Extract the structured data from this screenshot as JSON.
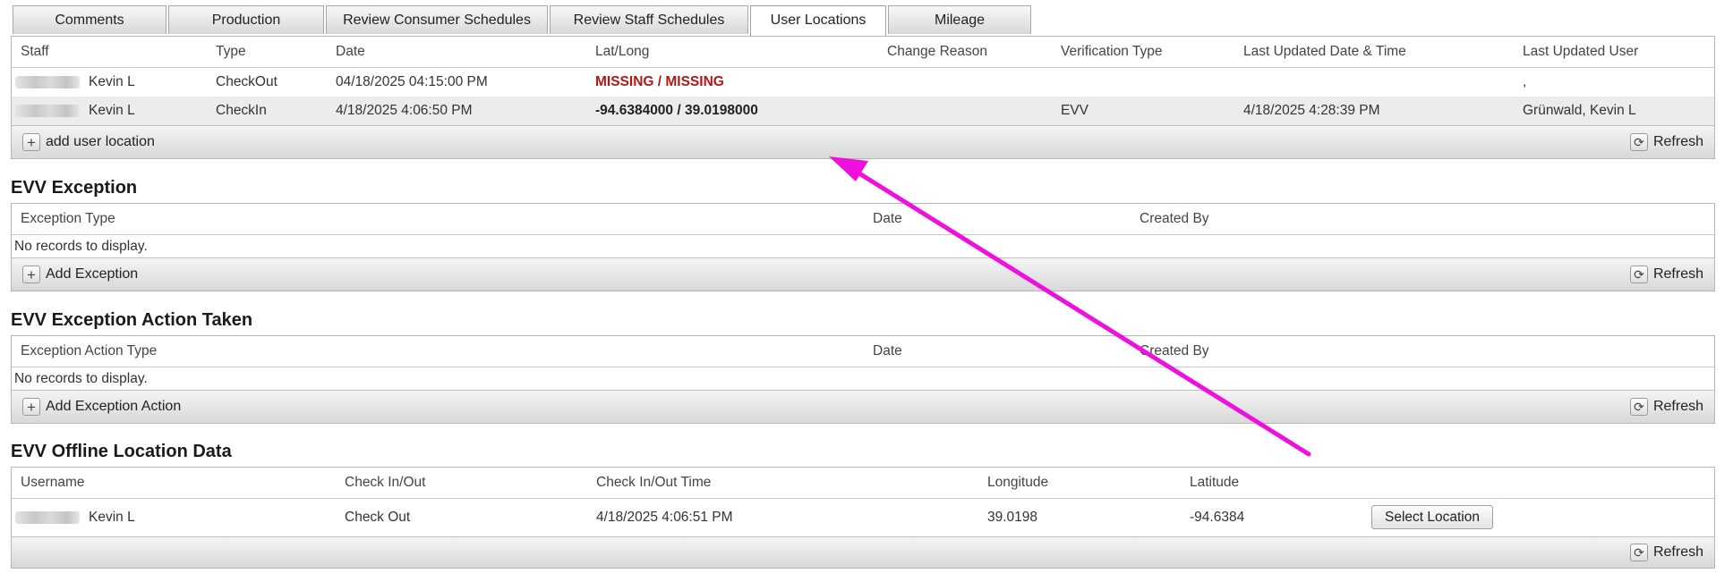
{
  "tabs": [
    {
      "label": "Comments"
    },
    {
      "label": "Production"
    },
    {
      "label": "Review Consumer Schedules"
    },
    {
      "label": "Review Staff Schedules"
    },
    {
      "label": "User Locations"
    },
    {
      "label": "Mileage"
    }
  ],
  "active_tab": "User Locations",
  "user_locations": {
    "columns": [
      "Staff",
      "Type",
      "Date",
      "Lat/Long",
      "Change Reason",
      "Verification Type",
      "Last Updated Date & Time",
      "Last Updated User"
    ],
    "rows": [
      {
        "staff": "Kevin L",
        "type": "CheckOut",
        "date": "04/18/2025 04:15:00 PM",
        "latlong": "MISSING / MISSING",
        "change_reason": "",
        "verification_type": "",
        "last_updated": "",
        "last_user": ","
      },
      {
        "staff": "Kevin L",
        "type": "CheckIn",
        "date": "4/18/2025 4:06:50 PM",
        "latlong": "-94.6384000 / 39.0198000",
        "change_reason": "",
        "verification_type": "EVV",
        "last_updated": "4/18/2025 4:28:39 PM",
        "last_user": "Grünwald, Kevin L"
      }
    ],
    "add_label": "add user location",
    "refresh_label": "Refresh"
  },
  "evv_exception": {
    "title": "EVV Exception",
    "columns": [
      "Exception Type",
      "Date",
      "Created By"
    ],
    "empty_text": "No records to display.",
    "add_label": "Add Exception",
    "refresh_label": "Refresh"
  },
  "evv_exception_action": {
    "title": "EVV Exception Action Taken",
    "columns": [
      "Exception Action Type",
      "Date",
      "Created By"
    ],
    "empty_text": "No records to display.",
    "add_label": "Add Exception Action",
    "refresh_label": "Refresh"
  },
  "evv_offline": {
    "title": "EVV Offline Location Data",
    "columns": [
      "Username",
      "Check In/Out",
      "Check In/Out Time",
      "Longitude",
      "Latitude"
    ],
    "rows": [
      {
        "username": "Kevin L",
        "check": "Check Out",
        "time": "4/18/2025 4:06:51 PM",
        "longitude": "39.0198",
        "latitude": "-94.6384",
        "action_label": "Select Location"
      }
    ],
    "refresh_label": "Refresh"
  },
  "colors": {
    "missing": "#b41616",
    "annotation_arrow": "#ee11dd"
  }
}
